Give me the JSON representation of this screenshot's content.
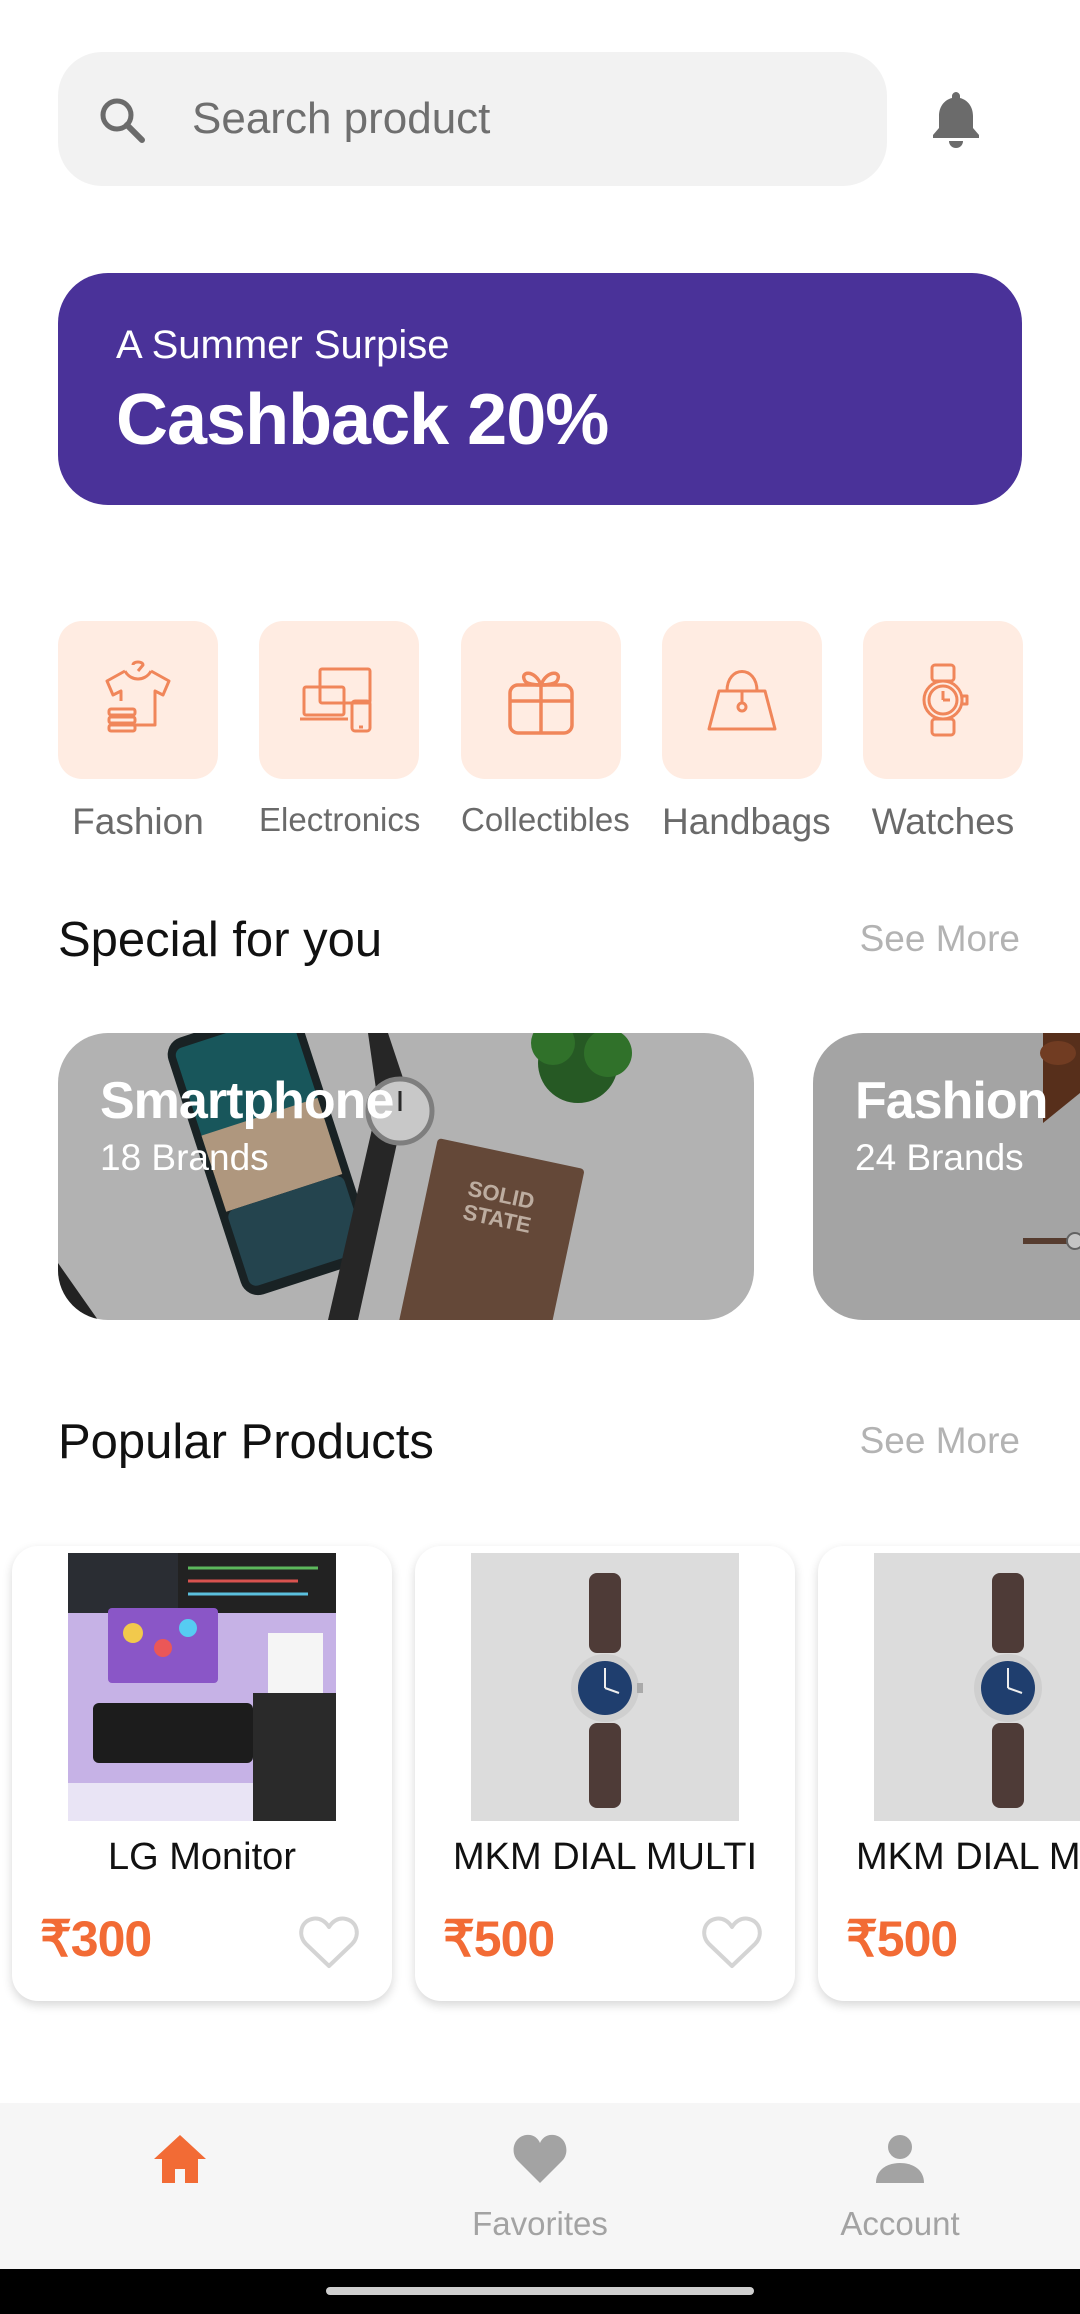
{
  "search": {
    "placeholder": "Search product",
    "icon": "search-icon"
  },
  "header": {
    "notification_icon": "bell-icon"
  },
  "banner": {
    "subtitle": "A Summer Surpise",
    "title": "Cashback 20%",
    "color": "#4a3299"
  },
  "categories": [
    {
      "label": "Fashion",
      "icon": "shirt-icon"
    },
    {
      "label": "Electronics",
      "icon": "devices-icon"
    },
    {
      "label": "Collectibles",
      "icon": "gift-icon"
    },
    {
      "label": "Handbags",
      "icon": "handbag-icon"
    },
    {
      "label": "Watches",
      "icon": "watch-icon"
    }
  ],
  "special": {
    "title": "Special for you",
    "see_more": "See More",
    "items": [
      {
        "title": "Smartphone",
        "subtitle": "18 Brands"
      },
      {
        "title": "Fashion",
        "subtitle": "24 Brands"
      }
    ]
  },
  "popular": {
    "title": "Popular Products",
    "see_more": "See More",
    "items": [
      {
        "name": "LG Monitor",
        "price": "₹300"
      },
      {
        "name": "MKM DIAL MULTI",
        "price": "₹500"
      },
      {
        "name": "MKM DIAL MULTI",
        "price": "₹500"
      }
    ]
  },
  "nav": {
    "active": "home",
    "items": [
      {
        "label": "",
        "icon": "home-icon"
      },
      {
        "label": "Favorites",
        "icon": "heart-icon"
      },
      {
        "label": "Account",
        "icon": "user-icon"
      }
    ]
  },
  "colors": {
    "accent": "#f26b35",
    "category_bg": "#ffece2",
    "muted": "#a3a3a3"
  }
}
